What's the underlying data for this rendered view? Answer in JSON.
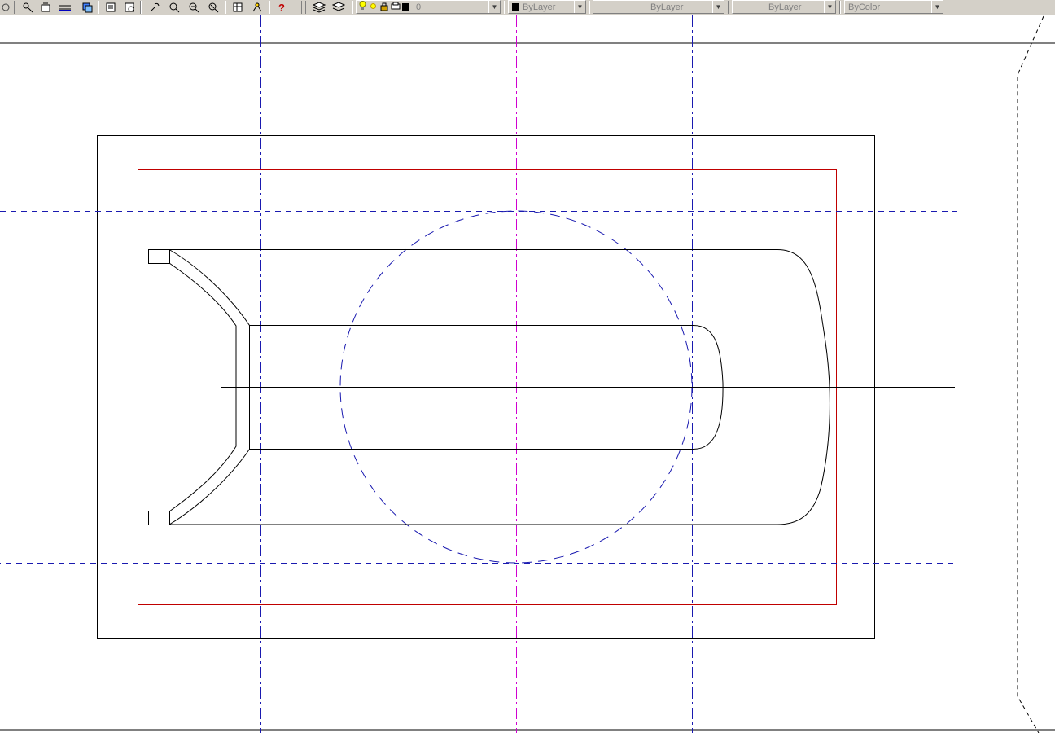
{
  "toolbar": {
    "layer_name": "0",
    "color_value": "ByLayer",
    "linetype_value": "ByLayer",
    "lineweight_value": "ByLayer",
    "plotstyle_value": "ByColor",
    "help_glyph": "?",
    "icons": [
      "pan-icon",
      "properties-match-icon",
      "layer-properties-icon",
      "dimension-icon",
      "copy-icon",
      "named-views-icon",
      "zoom-realtime-icon",
      "zoom-window-icon",
      "zoom-previous-icon",
      "zoom-extents-icon",
      "tool-palettes-icon",
      "design-center-icon",
      "help-icon",
      "layer-manager-icon",
      "layer-previous-icon",
      "bulb-on-icon",
      "sun-icon",
      "lock-icon",
      "plot-icon",
      "color-swatch-icon"
    ]
  },
  "colors": {
    "toolbar_bg": "#d4d0c8",
    "blue_dashed": "#1a1ab0",
    "magenta_center": "#d000d0",
    "red_border": "#c00000",
    "black_lines": "#000000",
    "canvas_bg": "#ffffff"
  }
}
